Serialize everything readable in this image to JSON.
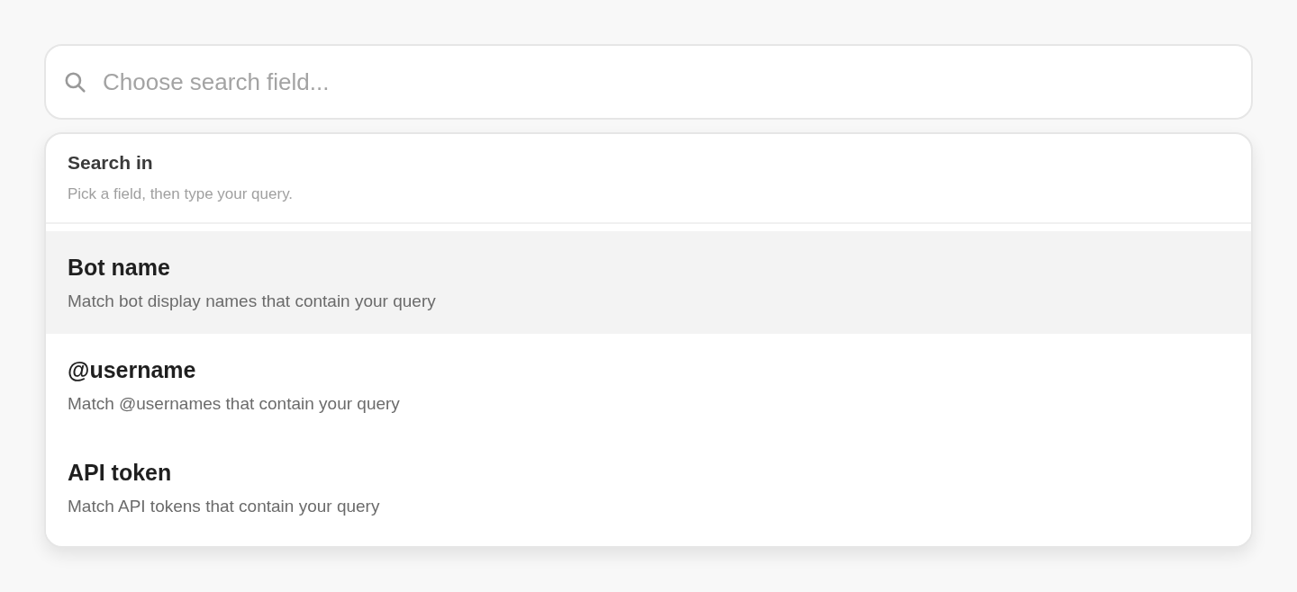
{
  "search": {
    "placeholder": "Choose search field..."
  },
  "dropdown": {
    "title": "Search in",
    "hint": "Pick a field, then type your query.",
    "options": [
      {
        "label": "Bot name",
        "description": "Match bot display names that contain your query",
        "selected": true
      },
      {
        "label": "@username",
        "description": "Match @usernames that contain your query",
        "selected": false
      },
      {
        "label": "API token",
        "description": "Match API tokens that contain your query",
        "selected": false
      }
    ]
  }
}
